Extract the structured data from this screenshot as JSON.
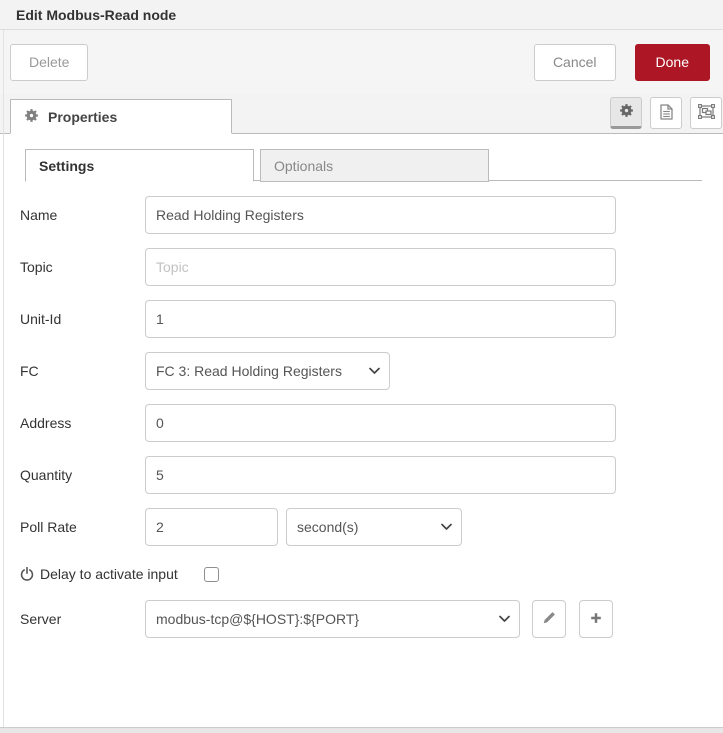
{
  "dialog": {
    "title": "Edit Modbus-Read node"
  },
  "toolbar": {
    "delete": "Delete",
    "cancel": "Cancel",
    "done": "Done"
  },
  "colors": {
    "accent": "#AD1625",
    "header_bg": "#f3f3f3",
    "border": "#bbbbbb"
  },
  "properties_tab": {
    "label": "Properties"
  },
  "icons": {
    "properties_tab": "gear-icon",
    "settings_button": "gear-icon",
    "description_button": "document-icon",
    "appearance_button": "object-group-icon",
    "delay": "power-icon",
    "edit_server": "pencil-icon",
    "add_server": "plus-icon",
    "dropdowns": "chevron-down-icon"
  },
  "tabs": [
    {
      "label": "Settings",
      "active": true
    },
    {
      "label": "Optionals",
      "active": false
    }
  ],
  "fields": {
    "name": {
      "label": "Name",
      "value": "Read Holding Registers"
    },
    "topic": {
      "label": "Topic",
      "value": "",
      "placeholder": "Topic"
    },
    "unit_id": {
      "label": "Unit-Id",
      "value": "1"
    },
    "fc": {
      "label": "FC",
      "value": "FC 3: Read Holding Registers"
    },
    "address": {
      "label": "Address",
      "value": "0"
    },
    "quantity": {
      "label": "Quantity",
      "value": "5"
    },
    "poll_rate": {
      "label": "Poll Rate",
      "value": "2",
      "unit": "second(s)"
    },
    "delay": {
      "label": "Delay to activate input",
      "checked": false
    },
    "server": {
      "label": "Server",
      "value": "modbus-tcp@${HOST}:${PORT}"
    }
  }
}
